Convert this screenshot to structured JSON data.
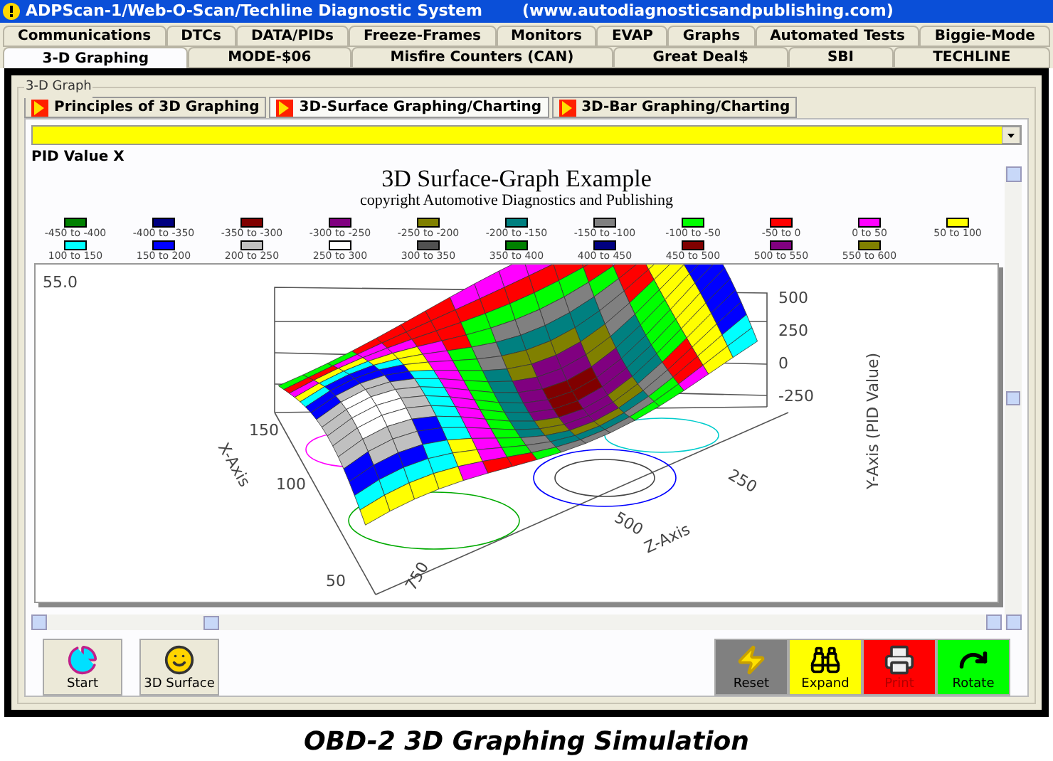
{
  "window": {
    "title": "ADPScan-1/Web-O-Scan/Techline Diagnostic System",
    "url": "(www.autodiagnosticsandpublishing.com)"
  },
  "tab_rows": [
    [
      {
        "label": "Communications",
        "selected": false
      },
      {
        "label": "DTCs",
        "selected": false
      },
      {
        "label": "DATA/PIDs",
        "selected": false
      },
      {
        "label": "Freeze-Frames",
        "selected": false
      },
      {
        "label": "Monitors",
        "selected": false
      },
      {
        "label": "EVAP",
        "selected": false
      },
      {
        "label": "Graphs",
        "selected": false
      },
      {
        "label": "Automated Tests",
        "selected": false
      },
      {
        "label": "Biggie-Mode",
        "selected": false
      }
    ],
    [
      {
        "label": "3-D Graphing",
        "selected": true
      },
      {
        "label": "MODE-$06",
        "selected": false
      },
      {
        "label": "Misfire Counters (CAN)",
        "selected": false
      },
      {
        "label": "Great Deal$",
        "selected": false
      },
      {
        "label": "SBI",
        "selected": false
      },
      {
        "label": "TECHLINE",
        "selected": false
      }
    ]
  ],
  "group": {
    "title": "3-D Graph"
  },
  "sub_tabs": [
    {
      "label": "Principles of 3D Graphing",
      "selected": false
    },
    {
      "label": "3D-Surface Graphing/Charting",
      "selected": true
    },
    {
      "label": "3D-Bar Graphing/Charting",
      "selected": false
    }
  ],
  "pid_label": "PID Value X",
  "graph": {
    "title": "3D Surface-Graph Example",
    "subtitle": "copyright Automotive Diagnostics and Publishing",
    "legend": [
      {
        "label": "-450 to -400",
        "color": "#008000"
      },
      {
        "label": "-400 to -350",
        "color": "#000080"
      },
      {
        "label": "-350 to -300",
        "color": "#800000"
      },
      {
        "label": "-300 to -250",
        "color": "#800080"
      },
      {
        "label": "-250 to -200",
        "color": "#808000"
      },
      {
        "label": "-200 to -150",
        "color": "#008080"
      },
      {
        "label": "-150 to -100",
        "color": "#808080"
      },
      {
        "label": "-100 to -50",
        "color": "#00ff00"
      },
      {
        "label": "-50 to 0",
        "color": "#ff0000"
      },
      {
        "label": "0 to 50",
        "color": "#ff00ff"
      },
      {
        "label": "50 to 100",
        "color": "#ffff00"
      },
      {
        "label": "100 to 150",
        "color": "#00ffff"
      },
      {
        "label": "150 to 200",
        "color": "#0000ff"
      },
      {
        "label": "200 to 250",
        "color": "#c0c0c0"
      },
      {
        "label": "250 to 300",
        "color": "#ffffff"
      },
      {
        "label": "300 to 350",
        "color": "#505050"
      },
      {
        "label": "350 to 400",
        "color": "#008000"
      },
      {
        "label": "400 to 450",
        "color": "#000080"
      },
      {
        "label": "450 to 500",
        "color": "#800000"
      },
      {
        "label": "500 to 550",
        "color": "#800080"
      },
      {
        "label": "550 to 600",
        "color": "#808000"
      }
    ],
    "corner_value": "55.0",
    "y_ticks": [
      "500",
      "250",
      "0",
      "-250"
    ],
    "x_ticks": [
      "150",
      "100",
      "50"
    ],
    "z_ticks": [
      "250",
      "500",
      "750"
    ],
    "y_title": "Y-Axis (PID Value)",
    "x_title": "X-Axis",
    "z_title": "Z-Axis"
  },
  "left_buttons": [
    {
      "label": "Start",
      "kind": "start"
    },
    {
      "label": "3D Surface",
      "kind": "surface"
    }
  ],
  "right_buttons": [
    {
      "label": "Reset",
      "kind": "reset",
      "color": "#808080"
    },
    {
      "label": "Expand",
      "kind": "expand",
      "color": "#ffff00"
    },
    {
      "label": "Print",
      "kind": "print",
      "color": "#ff0000"
    },
    {
      "label": "Rotate",
      "kind": "rotate",
      "color": "#00ff00"
    }
  ],
  "caption": "OBD-2 3D Graphing Simulation"
}
